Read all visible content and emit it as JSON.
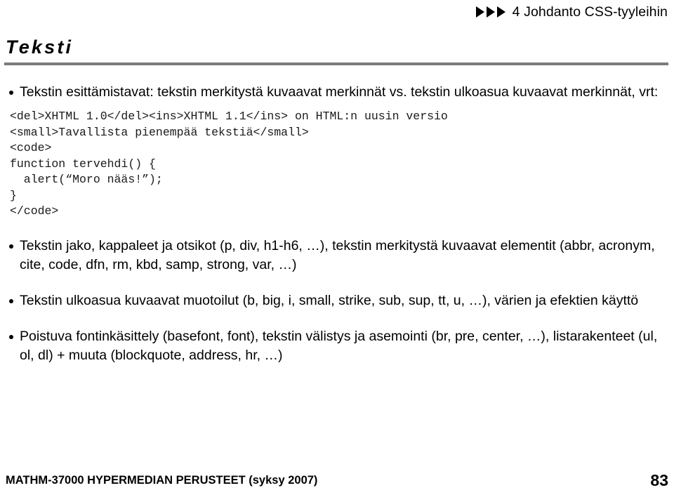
{
  "header": {
    "nav_icon": "triangle-right-icon",
    "nav_arrow_count": 3,
    "title": "4 Johdanto CSS-tyyleihin"
  },
  "slide": {
    "title": "Teksti",
    "rule_color": "#7b7b7b",
    "bullets": [
      {
        "text": "Tekstin esittämistavat: tekstin merkitystä kuvaavat merkinnät vs. tekstin ulkoasua kuvaavat merkinnät, vrt:"
      },
      {
        "text": "Tekstin jako, kappaleet ja otsikot (p, div, h1-h6, …), tekstin merkitystä kuvaavat elementit (abbr, acronym, cite, code, dfn, rm, kbd, samp, strong, var, …)"
      },
      {
        "text": "Tekstin ulkoasua kuvaavat muotoilut (b, big, i, small, strike, sub, sup, tt, u, …), värien ja efektien käyttö"
      },
      {
        "text": "Poistuva fontinkäsittely (basefont, font), tekstin välistys ja asemointi (br, pre, center, …), listarakenteet (ul, ol, dl) + muuta (blockquote, address, hr, …)"
      }
    ],
    "code": "<del>XHTML 1.0</del><ins>XHTML 1.1</ins> on HTML:n uusin versio\n<small>Tavallista pienempää tekstiä</small>\n<code>\nfunction tervehdi() {\n  alert(“Moro nääs!”);\n}\n</code>"
  },
  "footer": {
    "course": "MATHM-37000 HYPERMEDIAN PERUSTEET (syksy 2007)",
    "page": "83"
  }
}
